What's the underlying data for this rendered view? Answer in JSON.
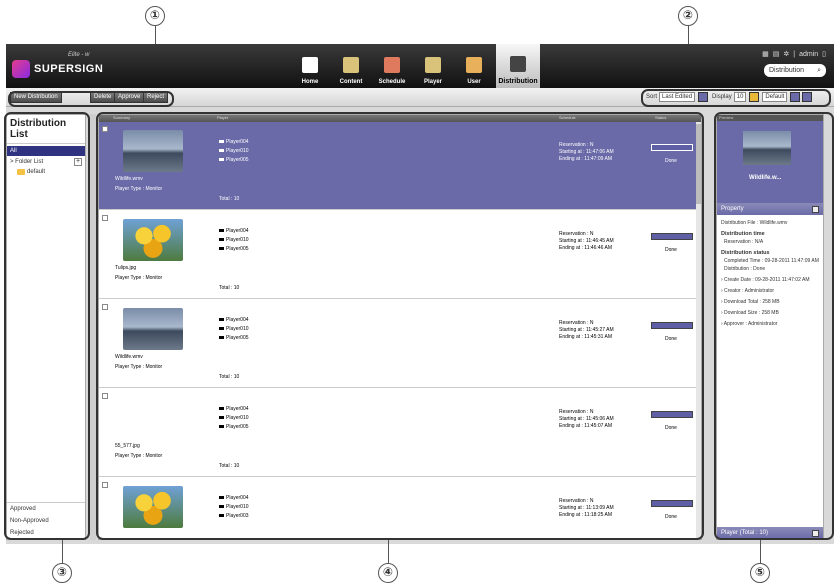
{
  "callouts": [
    "①",
    "②",
    "③",
    "④",
    "⑤"
  ],
  "app": {
    "logo": {
      "name": "SUPERSIGN",
      "sub": "Elite - w"
    },
    "nav": [
      {
        "label": "Home",
        "icon": "home-icon",
        "color": "#ffffff"
      },
      {
        "label": "Content",
        "icon": "content-icon",
        "color": "#d9c27a"
      },
      {
        "label": "Schedule",
        "icon": "schedule-icon",
        "color": "#e07a5f"
      },
      {
        "label": "Player",
        "icon": "player-icon",
        "color": "#d9c27a"
      },
      {
        "label": "User",
        "icon": "user-icon",
        "color": "#e8b05a"
      },
      {
        "label": "Distribution",
        "icon": "distribution-icon",
        "color": "#444444",
        "active": true
      }
    ],
    "header_right": {
      "user": "admin",
      "separator": "|",
      "search_value": "Distribution"
    },
    "toolbar": {
      "new_distribution": "New Distribution",
      "delete": "Delete",
      "approve": "Approve",
      "reject": "Reject",
      "sort_label": "Sort",
      "sort_value": "Last Edited",
      "display_label": "Display",
      "display_value": "10",
      "view_value": "Default"
    },
    "left_panel": {
      "title": "Distribution List",
      "all": "All",
      "folder_list": "> Folder List",
      "folder_default": "default",
      "filters": [
        "Approved",
        "Non-Approved",
        "Rejected"
      ]
    },
    "table": {
      "columns": [
        "Summary",
        "Player",
        "Schedule",
        "Status"
      ],
      "rows": [
        {
          "file": "Wildlife.wmv",
          "player_type": "Player Type : Monitor",
          "thumb": "dune",
          "players": [
            "Player004",
            "Player010",
            "Player005"
          ],
          "total": "Total : 10",
          "reservation": "Reservation : N",
          "start": "Starting at    : 11:47:06 AM",
          "end": "Ending at     : 11:47:09 AM",
          "progress": 1.0,
          "status": "Done",
          "selected": true
        },
        {
          "file": "Tulips.jpg",
          "player_type": "Player Type : Monitor",
          "thumb": "tulip",
          "players": [
            "Player004",
            "Player010",
            "Player005"
          ],
          "total": "Total : 10",
          "reservation": "Reservation : N",
          "start": "Starting at    : 11:46:45 AM",
          "end": "Ending at     : 11:46:46 AM",
          "progress": 1.0,
          "status": "Done",
          "selected": false
        },
        {
          "file": "Wildlife.wmv",
          "player_type": "Player Type : Monitor",
          "thumb": "dune",
          "players": [
            "Player004",
            "Player010",
            "Player005"
          ],
          "total": "Total : 10",
          "reservation": "Reservation : N",
          "start": "Starting at    : 11:45:27 AM",
          "end": "Ending at     : 11:45:31 AM",
          "progress": 1.0,
          "status": "Done",
          "selected": false
        },
        {
          "file": "55_577.jpg",
          "player_type": "Player Type : Monitor",
          "thumb": "sketch",
          "players": [
            "Player004",
            "Player010",
            "Player005"
          ],
          "total": "Total : 10",
          "reservation": "Reservation : N",
          "start": "Starting at    : 11:45:06 AM",
          "end": "Ending at     : 11:45:07 AM",
          "progress": 1.0,
          "status": "Done",
          "selected": false
        },
        {
          "file": "",
          "player_type": "",
          "thumb": "tulip",
          "players": [
            "Player004",
            "Player010",
            "Player003"
          ],
          "total": "",
          "reservation": "Reservation : N",
          "start": "Starting at    : 11:13:09 AM",
          "end": "Ending at     : 11:18:25 AM",
          "progress": 1.0,
          "status": "Done",
          "selected": false
        }
      ]
    },
    "right_panel": {
      "preview_label": "Preview",
      "preview_name": "Wildlife.w...",
      "property_title": "Property",
      "distribution_file": "Distribution File : Wildlife.wmv",
      "distribution_time_title": "Distribution time",
      "reservation": "Reservation    : N/A",
      "distribution_status_title": "Distribution status",
      "completed_time": "Completed Time : 09-28-2011 11:47:09 AM",
      "distribution": "Distribution    : Done",
      "create_date": "› Create Date     :   09-28-2011 11:47:02 AM",
      "creator": "› Creator          :   Administrator",
      "download_total": "› Download Total :   258 MB",
      "download_size": "› Download Size  :   258 MB",
      "approver": "› Approver        :   Administrator",
      "player_footer": "Player (Total : 10)"
    }
  }
}
